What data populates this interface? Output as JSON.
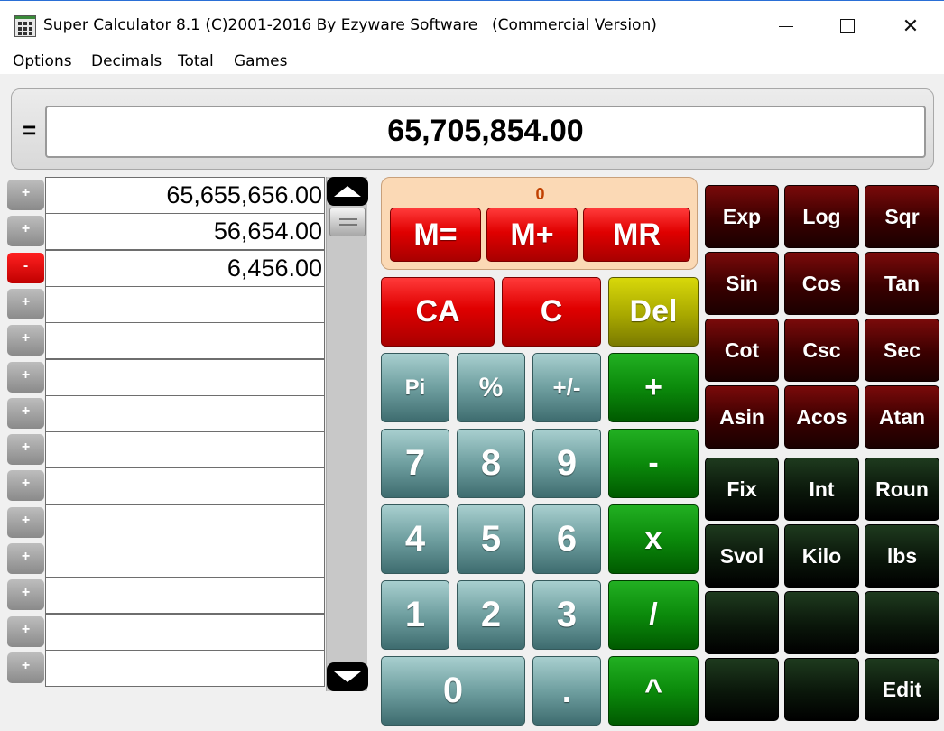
{
  "window": {
    "title": "Super Calculator 8.1 (C)2001-2016 By Ezyware Software",
    "edition": "(Commercial Version)",
    "minimize_icon": "minimize-icon",
    "maximize_icon": "maximize-icon",
    "close_label": "✕"
  },
  "menu": [
    "Options",
    "Decimals",
    "Total",
    "Games"
  ],
  "display": {
    "equals": "=",
    "value": "65,705,854.00"
  },
  "tape": [
    {
      "sign": "+",
      "value": "65,655,656.00"
    },
    {
      "sign": "+",
      "value": "56,654.00"
    },
    {
      "sign": "-",
      "value": "6,456.00"
    },
    {
      "sign": "+",
      "value": ""
    },
    {
      "sign": "+",
      "value": ""
    },
    {
      "sign": "+",
      "value": ""
    },
    {
      "sign": "+",
      "value": ""
    },
    {
      "sign": "+",
      "value": ""
    },
    {
      "sign": "+",
      "value": ""
    },
    {
      "sign": "+",
      "value": ""
    },
    {
      "sign": "+",
      "value": ""
    },
    {
      "sign": "+",
      "value": ""
    },
    {
      "sign": "+",
      "value": ""
    },
    {
      "sign": "+",
      "value": ""
    }
  ],
  "memory": {
    "value": "0",
    "buttons": [
      "M=",
      "M+",
      "MR"
    ]
  },
  "control_buttons": [
    "CA",
    "C",
    "Del"
  ],
  "keypad": {
    "func": [
      "Pi",
      "%",
      "+/-"
    ],
    "digits_row1": [
      "7",
      "8",
      "9"
    ],
    "digits_row2": [
      "4",
      "5",
      "6"
    ],
    "digits_row3": [
      "1",
      "2",
      "3"
    ],
    "zero": "0",
    "dot": ".",
    "ops": [
      "+",
      "-",
      "x",
      "/",
      "^"
    ]
  },
  "sci_buttons": [
    [
      "Exp",
      "Log",
      "Sqr"
    ],
    [
      "Sin",
      "Cos",
      "Tan"
    ],
    [
      "Cot",
      "Csc",
      "Sec"
    ],
    [
      "Asin",
      "Acos",
      "Atan"
    ]
  ],
  "util_buttons": [
    [
      "Fix",
      "Int",
      "Roun"
    ],
    [
      "Svol",
      "Kilo",
      "lbs"
    ],
    [
      "",
      "",
      ""
    ],
    [
      "",
      "",
      "Edit"
    ]
  ],
  "colors": {
    "red": "#e00000",
    "olive": "#a8a800",
    "teal": "#6f9fa0",
    "green": "#0b8a0b",
    "maroon": "#3a0000",
    "dark": "#0a160a",
    "memory_panel": "#fbd9b5"
  }
}
